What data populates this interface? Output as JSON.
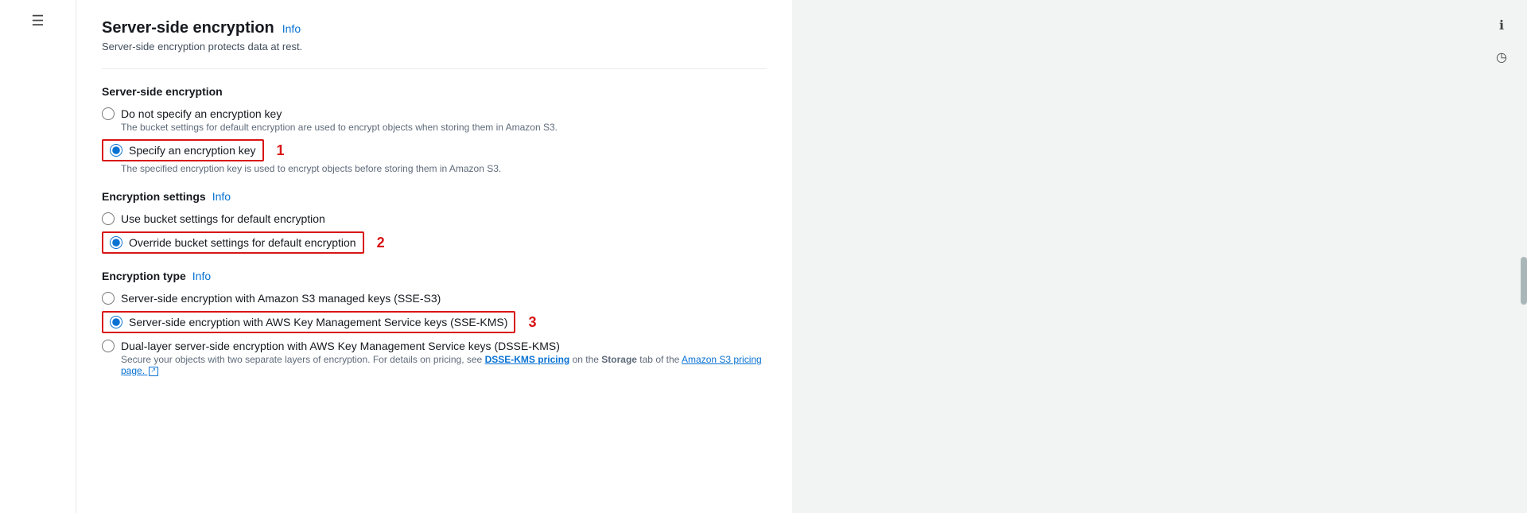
{
  "sidebar": {
    "hamburger_icon": "☰"
  },
  "panel": {
    "title": "Server-side encryption",
    "info_link": "Info",
    "subtitle": "Server-side encryption protects data at rest."
  },
  "server_side_encryption": {
    "section_title": "Server-side encryption",
    "options": [
      {
        "id": "no-key",
        "label": "Do not specify an encryption key",
        "description": "The bucket settings for default encryption are used to encrypt objects when storing them in Amazon S3.",
        "checked": false,
        "highlighted": false
      },
      {
        "id": "specify-key",
        "label": "Specify an encryption key",
        "description": "The specified encryption key is used to encrypt objects before storing them in Amazon S3.",
        "checked": true,
        "highlighted": true,
        "annotation": "1"
      }
    ]
  },
  "encryption_settings": {
    "section_title": "Encryption settings",
    "info_link": "Info",
    "options": [
      {
        "id": "use-bucket",
        "label": "Use bucket settings for default encryption",
        "checked": false,
        "highlighted": false
      },
      {
        "id": "override-bucket",
        "label": "Override bucket settings for default encryption",
        "checked": true,
        "highlighted": true,
        "annotation": "2"
      }
    ]
  },
  "encryption_type": {
    "section_title": "Encryption type",
    "info_link": "Info",
    "options": [
      {
        "id": "sse-s3",
        "label": "Server-side encryption with Amazon S3 managed keys (SSE-S3)",
        "checked": false,
        "highlighted": false
      },
      {
        "id": "sse-kms",
        "label": "Server-side encryption with AWS Key Management Service keys (SSE-KMS)",
        "checked": true,
        "highlighted": true,
        "annotation": "3"
      },
      {
        "id": "dsse-kms",
        "label": "Dual-layer server-side encryption with AWS Key Management Service keys (DSSE-KMS)",
        "description_parts": [
          "Secure your objects with two separate layers of encryption. For details on pricing, see ",
          "DSSE-KMS pricing",
          " on the ",
          "Storage",
          " tab of the ",
          "Amazon S3 pricing page.",
          " ↗"
        ],
        "checked": false,
        "highlighted": false
      }
    ]
  },
  "right_icons": {
    "info_icon": "ℹ",
    "history_icon": "◷"
  }
}
